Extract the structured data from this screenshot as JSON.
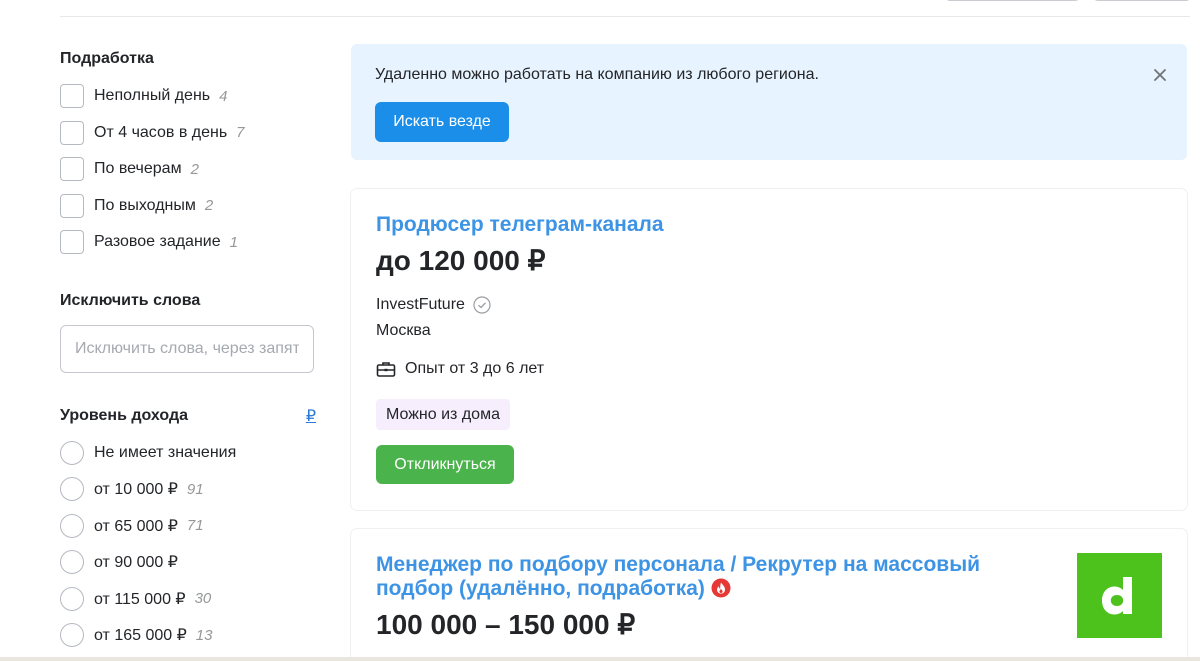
{
  "sidebar": {
    "parttime": {
      "title": "Подработка",
      "options": [
        {
          "label": "Неполный день",
          "count": "4"
        },
        {
          "label": "От 4 часов в день",
          "count": "7"
        },
        {
          "label": "По вечерам",
          "count": "2"
        },
        {
          "label": "По выходным",
          "count": "2"
        },
        {
          "label": "Разовое задание",
          "count": "1"
        }
      ]
    },
    "exclude": {
      "title": "Исключить слова",
      "placeholder": "Исключить слова, через запятую"
    },
    "income": {
      "title": "Уровень дохода",
      "currency": "₽",
      "options": [
        {
          "label": "Не имеет значения",
          "count": ""
        },
        {
          "label": "от 10 000 ₽",
          "count": "91"
        },
        {
          "label": "от 65 000 ₽",
          "count": "71"
        },
        {
          "label": "от 90 000 ₽",
          "count": ""
        },
        {
          "label": "от 115 000 ₽",
          "count": "30"
        },
        {
          "label": "от 165 000 ₽",
          "count": "13"
        }
      ]
    }
  },
  "banner": {
    "text": "Удаленно можно работать на компанию из любого региона.",
    "button": "Искать везде",
    "close_icon": "close-icon"
  },
  "vacancies": [
    {
      "title": "Продюсер телеграм-канала",
      "salary": "до 120 000 ₽",
      "company": "InvestFuture",
      "city": "Москва",
      "experience": "Опыт от 3 до 6 лет",
      "tag": "Можно из дома",
      "respond": "Откликнуться"
    },
    {
      "title": "Менеджер по подбору персонала / Рекрутер на массовый подбор (удалённо, подработка)",
      "salary": "100 000 – 150 000 ₽",
      "logo_letter": "d"
    }
  ],
  "colors": {
    "accent_blue": "#1a8ee8",
    "title_blue": "#3d93e4",
    "respond_green": "#4bb34b",
    "banner_bg": "#e7f3fe",
    "logo_green": "#4dc21d"
  }
}
